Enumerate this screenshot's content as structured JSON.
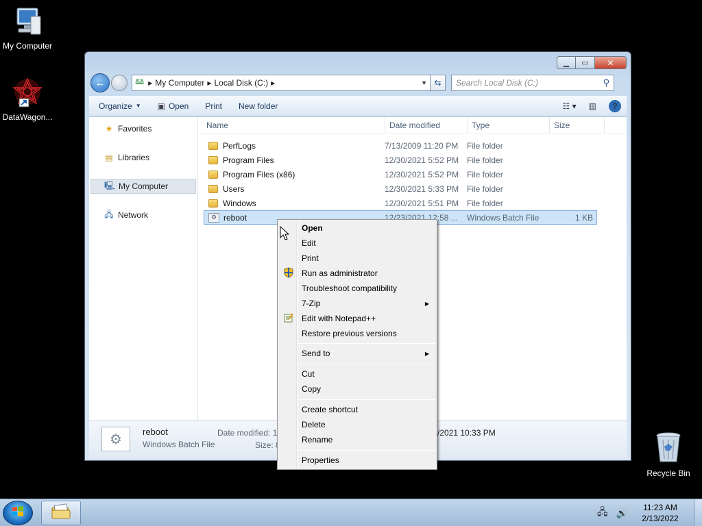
{
  "desktop": {
    "icons": [
      {
        "label": "My Computer"
      },
      {
        "label": "DataWagon..."
      },
      {
        "label": "Recycle Bin"
      }
    ]
  },
  "window": {
    "address": {
      "crumbs": [
        "My Computer",
        "Local Disk (C:)"
      ]
    },
    "search": {
      "placeholder": "Search Local Disk (C:)"
    },
    "toolbar": {
      "organize": "Organize",
      "open": "Open",
      "print": "Print",
      "new_folder": "New folder"
    }
  },
  "navpane": {
    "items": [
      {
        "label": "Favorites"
      },
      {
        "label": "Libraries"
      },
      {
        "label": "My Computer",
        "selected": true
      },
      {
        "label": "Network"
      }
    ]
  },
  "columns": {
    "name": "Name",
    "date": "Date modified",
    "type": "Type",
    "size": "Size"
  },
  "files": [
    {
      "name": "PerfLogs",
      "date": "7/13/2009 11:20 PM",
      "type": "File folder",
      "size": ""
    },
    {
      "name": "Program Files",
      "date": "12/30/2021 5:52 PM",
      "type": "File folder",
      "size": ""
    },
    {
      "name": "Program Files (x86)",
      "date": "12/30/2021 5:52 PM",
      "type": "File folder",
      "size": ""
    },
    {
      "name": "Users",
      "date": "12/30/2021 5:33 PM",
      "type": "File folder",
      "size": ""
    },
    {
      "name": "Windows",
      "date": "12/30/2021 5:51 PM",
      "type": "File folder",
      "size": ""
    },
    {
      "name": "reboot",
      "date": "12/23/2021 12:58 ...",
      "type": "Windows Batch File",
      "size": "1 KB",
      "selected": true
    }
  ],
  "details": {
    "name": "reboot",
    "type": "Windows Batch File",
    "date_label": "Date modified: 1",
    "size_label": "Size: 8",
    "date_tail": "/2021 10:33 PM"
  },
  "context_menu": {
    "items": [
      {
        "label": "Open",
        "bold": true
      },
      {
        "label": "Edit"
      },
      {
        "label": "Print"
      },
      {
        "label": "Run as administrator",
        "icon": "uac-shield-icon"
      },
      {
        "label": "Troubleshoot compatibility"
      },
      {
        "label": "7-Zip",
        "submenu": true
      },
      {
        "label": "Edit with Notepad++",
        "icon": "notepadpp-icon"
      },
      {
        "label": "Restore previous versions"
      },
      {
        "label": "Send to",
        "submenu": true
      },
      {
        "label": "Cut"
      },
      {
        "label": "Copy"
      },
      {
        "label": "Create shortcut"
      },
      {
        "label": "Delete"
      },
      {
        "label": "Rename"
      },
      {
        "label": "Properties"
      }
    ]
  },
  "taskbar": {
    "time": "11:23 AM",
    "date": "2/13/2022"
  }
}
